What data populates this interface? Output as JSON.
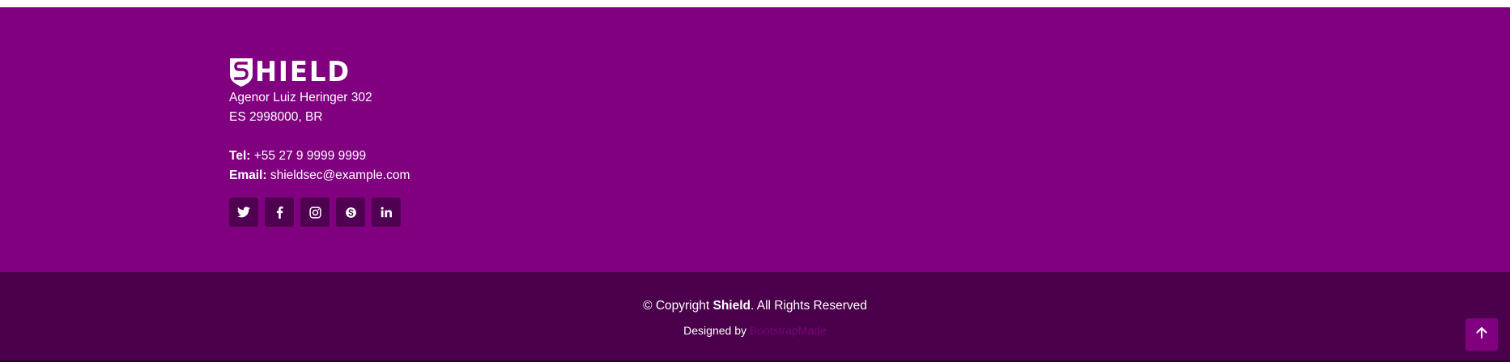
{
  "brand": {
    "logo_text": "HIELD",
    "logo_icon": "shield-s-icon"
  },
  "address": {
    "line1": "Agenor Luiz Heringer 302",
    "line2": "ES 2998000, BR"
  },
  "contact": {
    "tel_label": "Tel:",
    "tel_value": "+55 27 9 9999 9999",
    "email_label": "Email:",
    "email_value": "shieldsec@example.com"
  },
  "social": [
    {
      "name": "twitter-icon"
    },
    {
      "name": "facebook-icon"
    },
    {
      "name": "instagram-icon"
    },
    {
      "name": "skype-icon"
    },
    {
      "name": "linkedin-icon"
    }
  ],
  "copyright": {
    "prefix": "© Copyright ",
    "brand": "Shield",
    "suffix": ". All Rights Reserved"
  },
  "credits": {
    "prefix": "Designed by ",
    "link_text": "BootstrapMade"
  },
  "back_to_top": {
    "icon": "arrow-up-icon"
  },
  "colors": {
    "footer_top": "#800080",
    "footer_bottom": "#4a004a",
    "social_button": "#4f0050",
    "accent": "#800080"
  }
}
